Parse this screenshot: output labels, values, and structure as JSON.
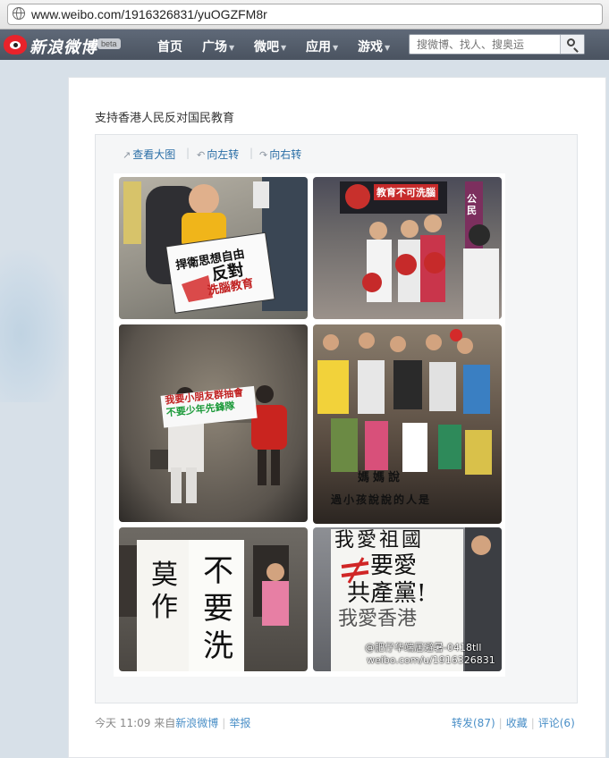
{
  "browser": {
    "url": "www.weibo.com/1916326831/yuOGZFM8r"
  },
  "nav": {
    "brand": "新浪微博",
    "beta": "beta",
    "items": [
      "首页",
      "广场",
      "微吧",
      "应用",
      "游戏"
    ],
    "search_placeholder": "搜微博、找人、搜奥运"
  },
  "post": {
    "text": "支持香港人民反对国民教育",
    "tools": [
      "查看大图",
      "向左转",
      "向右转"
    ],
    "photo_signs": {
      "p1_line1": "捍衛思想自由",
      "p1_line2": "反對",
      "p1_line3": "洗腦教育",
      "p2_banner": "教育不可洗腦",
      "p2_side": "公民",
      "p3_line1": "我要小朋友群抽會",
      "p3_line2": "不要少年先鋒隊",
      "p4_line1": "媽媽說",
      "p4_line2": "過小孩說說的人是",
      "p5_left": "莫作",
      "p5_right": "不要洗",
      "p6_line1": "我愛祖國",
      "p6_line2": "要愛",
      "p6_line3": "共產黨!",
      "p6_line4": "我愛香港"
    },
    "watermark_user": "@肥仔华端居避暑-0418tll",
    "watermark_url": "weibo.com/u/1916326831",
    "time": "今天 11:09",
    "source_prefix": "来自",
    "source": "新浪微博",
    "report": "举报",
    "repost": "转发(87)",
    "favorite": "收藏",
    "comment": "评论(6)"
  }
}
